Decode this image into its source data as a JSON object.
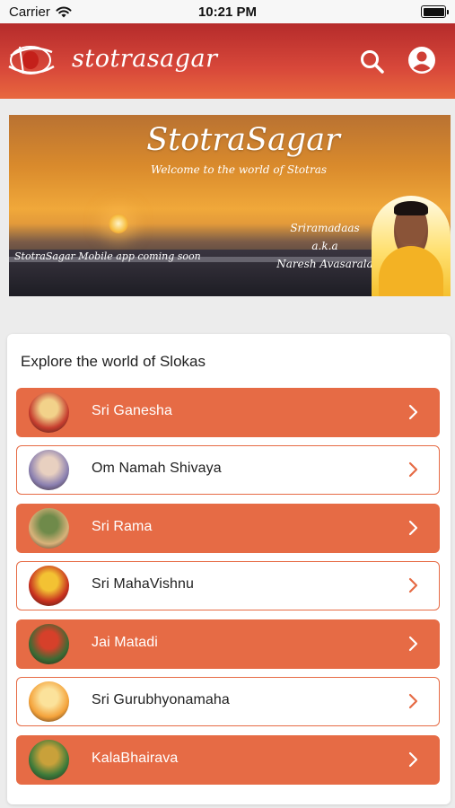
{
  "status_bar": {
    "carrier": "Carrier",
    "time": "10:21 PM",
    "wifi_icon": "wifi-icon",
    "battery_icon": "battery-icon"
  },
  "app_bar": {
    "title": "stotrasagar",
    "logo_icon": "logo-icon",
    "search_icon": "search-icon",
    "profile_icon": "account-circle-icon",
    "gradient": [
      "#b52b2b",
      "#e8683e"
    ]
  },
  "banner": {
    "title": "StotraSagar",
    "subtitle": "Welcome to the world of Stotras",
    "coming_soon": "StotraSagar Mobile app coming soon",
    "author_lines": [
      "Sriramadaas",
      "a.k.a",
      "Naresh Avasarala"
    ]
  },
  "slokas": {
    "heading": "Explore the world of Slokas",
    "accent_color": "#e66b45",
    "items": [
      {
        "label": "Sri Ganesha",
        "style": "filled",
        "thumb_colors": [
          "#c63d2e",
          "#f2d28a"
        ]
      },
      {
        "label": "Om Namah Shivaya",
        "style": "outlined",
        "thumb_colors": [
          "#8a7fb0",
          "#e8d0c0"
        ]
      },
      {
        "label": "Sri Rama",
        "style": "filled",
        "thumb_colors": [
          "#d9b27a",
          "#6f8a4a"
        ]
      },
      {
        "label": "Sri MahaVishnu",
        "style": "outlined",
        "thumb_colors": [
          "#c8301f",
          "#f3c233"
        ]
      },
      {
        "label": "Jai Matadi",
        "style": "filled",
        "thumb_colors": [
          "#3c6b34",
          "#d6402a"
        ]
      },
      {
        "label": "Sri Gurubhyonamaha",
        "style": "outlined",
        "thumb_colors": [
          "#f4a23a",
          "#fbe29b"
        ]
      },
      {
        "label": "KalaBhairava",
        "style": "filled",
        "thumb_colors": [
          "#3b7a3a",
          "#c9a13a"
        ]
      }
    ],
    "chevron_icon": "chevron-right-icon"
  }
}
